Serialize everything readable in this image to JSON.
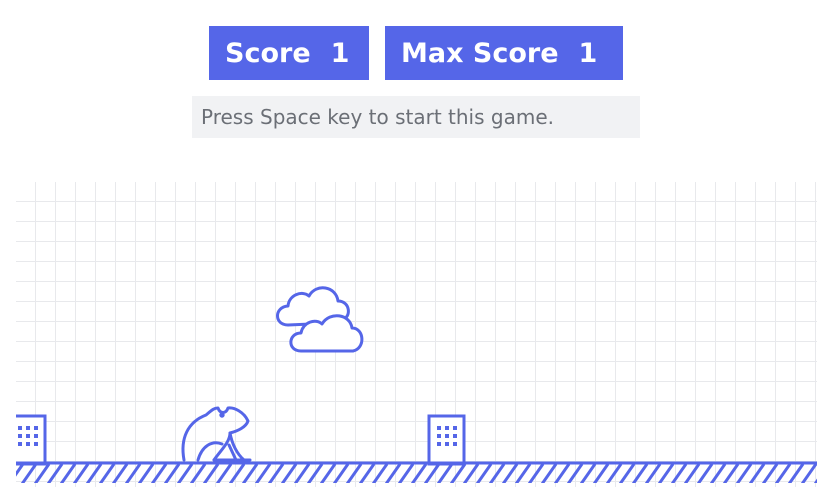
{
  "scoreboard": {
    "score_label": "Score",
    "score_value": "1",
    "max_score_label": "Max Score",
    "max_score_value": "1"
  },
  "hint": {
    "text": "Press Space key to start this game."
  },
  "game": {
    "accent_color": "#5566e8",
    "grid_color": "#e8e9ec",
    "player_icon": "frog-icon",
    "obstacle_icon": "building-icon",
    "background_icon": "clouds-icon"
  }
}
